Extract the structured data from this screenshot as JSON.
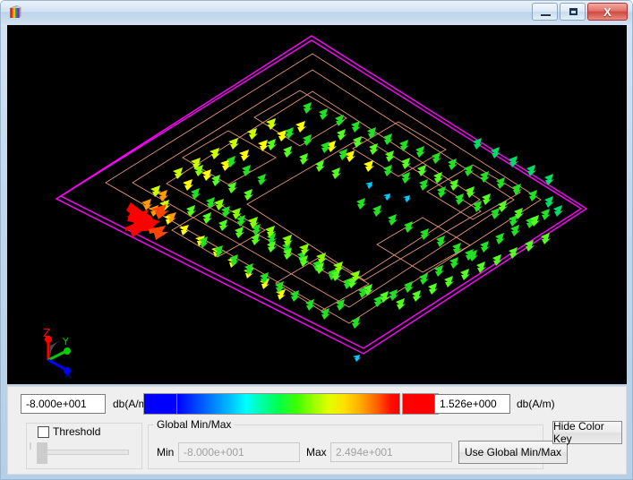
{
  "window": {
    "title": "",
    "icon": "rainbow-cube-icon",
    "controls": {
      "minimize": "minimize-button",
      "maximize": "maximize-button",
      "close_glyph": "X"
    }
  },
  "viewport": {
    "background": "#000000",
    "axis_triad": {
      "z_label": "Z",
      "z_color": "#ff0000",
      "y_label": "Y",
      "y_color": "#00cc00",
      "x_label": "X",
      "x_color": "#0000ff"
    },
    "outline_color": "#ff00ff",
    "trace_color": "#e8967a",
    "description": "3D vector field (surface current) plot of a spiral inductor / PCB trace"
  },
  "colorkey": {
    "min_value": "-8.000e+001",
    "min_unit": "db(A/m)",
    "max_value": "1.526e+000",
    "max_unit": "db(A/m)",
    "below_swatch_color": "#0000ff",
    "above_swatch_color": "#ff0000",
    "gradient_stops": [
      "#0000ff",
      "#0060ff",
      "#00c8ff",
      "#00ffe0",
      "#00ff40",
      "#5cff00",
      "#c8ff00",
      "#ffe000",
      "#ff8000",
      "#ff2000",
      "#ff0000"
    ]
  },
  "threshold": {
    "group_title": "",
    "checkbox_label": "Threshold",
    "checked": false,
    "slider_value": 0,
    "slider_enabled": false
  },
  "global_minmax": {
    "group_title": "Global Min/Max",
    "min_label": "Min",
    "min_value": "-8.000e+001",
    "max_label": "Max",
    "max_value": "2.494e+001",
    "apply_button": "Use Global Min/Max"
  },
  "actions": {
    "hide_color_key": "Hide Color Key"
  },
  "chart_data": {
    "type": "scatter",
    "title": "",
    "xlabel": "",
    "ylabel": "",
    "legend_min": "-8.000e+001",
    "legend_max": "1.526e+000",
    "unit": "db(A/m)",
    "colormap": "rainbow",
    "note": "Vector arrows colored by magnitude; peak (red) at feed point on left edge, bulk field green (~-30 dB), spiral trace outline in salmon, bounding box in magenta."
  }
}
